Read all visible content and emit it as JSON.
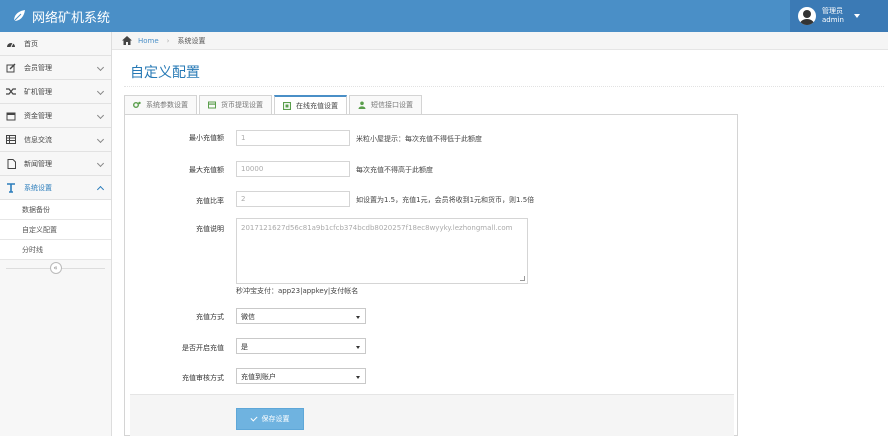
{
  "navbar": {
    "brand": "网络矿机系统",
    "user_role": "管理员",
    "user_name": "admin",
    "color": "#4a8fc7"
  },
  "sidebar": {
    "items": [
      {
        "label": "首页",
        "icon": "dashboard-icon"
      },
      {
        "label": "会员管理",
        "icon": "edit-icon"
      },
      {
        "label": "矿机管理",
        "icon": "shuffle-icon"
      },
      {
        "label": "资金管理",
        "icon": "calendar-icon"
      },
      {
        "label": "信息交流",
        "icon": "list-icon"
      },
      {
        "label": "新闻管理",
        "icon": "file-icon"
      },
      {
        "label": "系统设置",
        "icon": "text-icon"
      }
    ],
    "sub_items": [
      "数据备份",
      "自定义配置",
      "分时线"
    ],
    "collapse_icon": "«"
  },
  "breadcrumb": {
    "home": "Home",
    "separator": "›",
    "current": "系统设置"
  },
  "page": {
    "title": "自定义配置"
  },
  "tabs": [
    {
      "label": "系统参数设置",
      "icon": "gears-icon"
    },
    {
      "label": "货币提现设置",
      "icon": "credit-card-icon"
    },
    {
      "label": "在线充值设置",
      "icon": "square-icon"
    },
    {
      "label": "短信接口设置",
      "icon": "user-icon"
    }
  ],
  "form": {
    "min_recharge": {
      "label": "最小充值额",
      "value": "1",
      "hint": "米粒小屋提示：每次充值不得低于此额度"
    },
    "max_recharge": {
      "label": "最大充值额",
      "value": "10000",
      "hint": "每次充值不得高于此额度"
    },
    "ratio": {
      "label": "充值比率",
      "value": "2",
      "hint": "如设置为1.5，充值1元，会员将收到1元和货币，则1.5倍"
    },
    "description": {
      "label": "充值说明",
      "value": "2017121627d56c81a9b1cfcb374bcdb8020257f18ec8wyyky.lezhongmall.com",
      "note": "秒冲宝支付：app23|appkey|支付帐名"
    },
    "method": {
      "label": "充值方式",
      "value": "微信"
    },
    "enable": {
      "label": "是否开启充值",
      "value": "是"
    },
    "review": {
      "label": "充值审核方式",
      "value": "充值到账户"
    }
  },
  "actions": {
    "save_label": "保存设置"
  }
}
